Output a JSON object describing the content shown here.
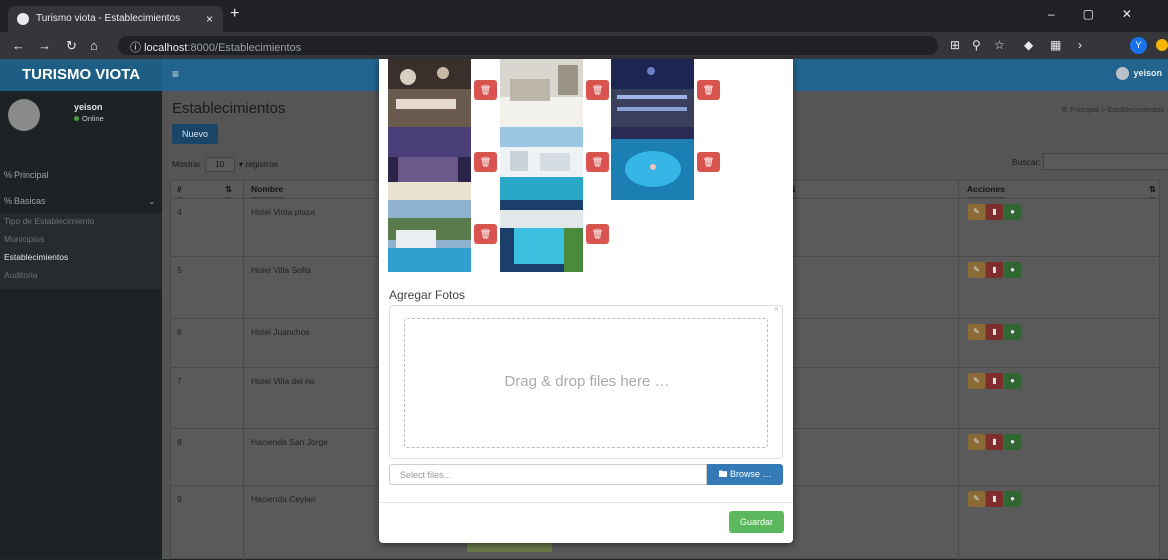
{
  "browser": {
    "tab_title": "Turismo viota - Establecimientos",
    "tab_close": "×",
    "new_tab": "+",
    "url_host": "localhost",
    "url_path": ":8000/Establecimientos",
    "info_icon": "ⓘ",
    "profile_initial": "Y"
  },
  "app": {
    "brand": "TURISMO VIOTA",
    "top_user": "yeison"
  },
  "sidebar": {
    "user_name": "yeison",
    "user_status": "Online",
    "principal": "Principal",
    "basicas": "Basicas",
    "sub_items": [
      "Tipo de Establecimiento",
      "Municipios",
      "Establecimientos",
      "Auditoria"
    ]
  },
  "page": {
    "title": "Establecimientos",
    "breadcrumb_home": "Principal",
    "breadcrumb_sep": ">",
    "breadcrumb_current": "Establecimientos",
    "nuevo_label": "Nuevo",
    "mostrar_label": "Mostrar",
    "page_size": "10",
    "registros_label": "registros",
    "buscar_label": "Buscar:"
  },
  "table": {
    "headers": [
      "#",
      "Nombre",
      "Acciones"
    ],
    "rows": [
      {
        "id": "4",
        "name": "Hotel Viota plaza"
      },
      {
        "id": "5",
        "name": "Hotel Villa Sofia"
      },
      {
        "id": "6",
        "name": "Hotel Juanchos"
      },
      {
        "id": "7",
        "name": "Hotel Villa del rio"
      },
      {
        "id": "8",
        "name": "Hacienda San Jorge"
      },
      {
        "id": "9",
        "name": "Hacienda Ceylan"
      }
    ]
  },
  "modal": {
    "agregar_label": "Agregar Fotos",
    "dropzone_text": "Drag & drop files here …",
    "select_files_placeholder": "Select files...",
    "browse_label": "Browse …",
    "guardar_label": "Guardar",
    "close_glyph": "×"
  },
  "colors": {
    "delete": "#d9534f",
    "browse": "#337ab7",
    "guardar": "#5cb85c",
    "topbar": "#23648f"
  }
}
